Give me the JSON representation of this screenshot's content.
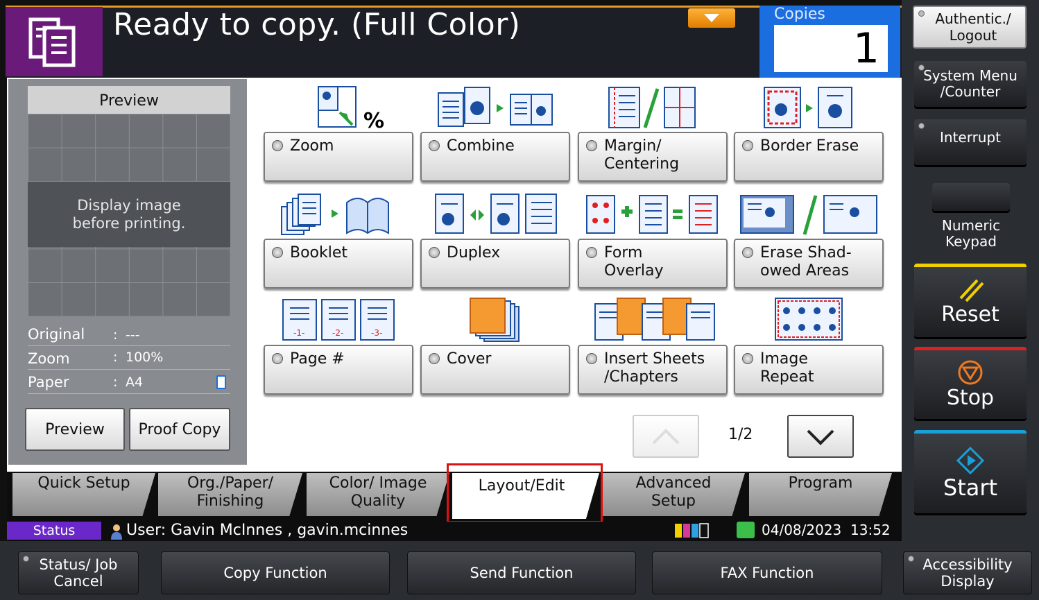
{
  "header": {
    "title": "Ready to copy. (Full Color)",
    "copies_label": "Copies",
    "copies_value": "1"
  },
  "side": {
    "auth": "Authentic./ Logout",
    "system_menu": "System Menu /Counter",
    "interrupt": "Interrupt",
    "numeric_keypad": "Numeric Keypad",
    "reset": "Reset",
    "stop": "Stop",
    "start": "Start"
  },
  "preview": {
    "heading": "Preview",
    "message": "Display image before printing.",
    "original_label": "Original",
    "original_value": "---",
    "zoom_label": "Zoom",
    "zoom_value": "100%",
    "paper_label": "Paper",
    "paper_value": "A4",
    "preview_button": "Preview",
    "proof_button": "Proof Copy"
  },
  "functions": [
    {
      "label": "Zoom",
      "icon": "zoom-icon"
    },
    {
      "label": "Combine",
      "icon": "combine-icon"
    },
    {
      "label": "Margin/ Centering",
      "icon": "margin-icon"
    },
    {
      "label": "Border Erase",
      "icon": "border-erase-icon"
    },
    {
      "label": "Booklet",
      "icon": "booklet-icon"
    },
    {
      "label": "Duplex",
      "icon": "duplex-icon"
    },
    {
      "label": "Form Overlay",
      "icon": "form-overlay-icon"
    },
    {
      "label": "Erase Shad- owed Areas",
      "icon": "erase-shadow-icon"
    },
    {
      "label": "Page #",
      "icon": "page-number-icon"
    },
    {
      "label": "Cover",
      "icon": "cover-icon"
    },
    {
      "label": "Insert Sheets /Chapters",
      "icon": "insert-sheets-icon"
    },
    {
      "label": "Image Repeat",
      "icon": "image-repeat-icon"
    }
  ],
  "pagination": {
    "indicator": "1/2"
  },
  "tabs": [
    {
      "label": "Quick Setup"
    },
    {
      "label": "Org./Paper/ Finishing"
    },
    {
      "label": "Color/ Image Quality"
    },
    {
      "label": "Layout/Edit"
    },
    {
      "label": "Advanced Setup"
    },
    {
      "label": "Program"
    }
  ],
  "status": {
    "tag": "Status",
    "user": "User: Gavin McInnes , gavin.mcinnes",
    "date": "04/08/2023",
    "time": "13:52"
  },
  "bottom": {
    "status_job": "Status/ Job Cancel",
    "copy": "Copy Function",
    "send": "Send Function",
    "fax": "FAX Function",
    "accessibility": "Accessibility Display"
  },
  "colors": {
    "accent_purple": "#6a1b7a",
    "copies_blue": "#1a6ee0",
    "highlight_red": "#e01010",
    "reset_yellow": "#f2d000",
    "stop_red": "#e02020",
    "start_cyan": "#1aa0d8"
  }
}
